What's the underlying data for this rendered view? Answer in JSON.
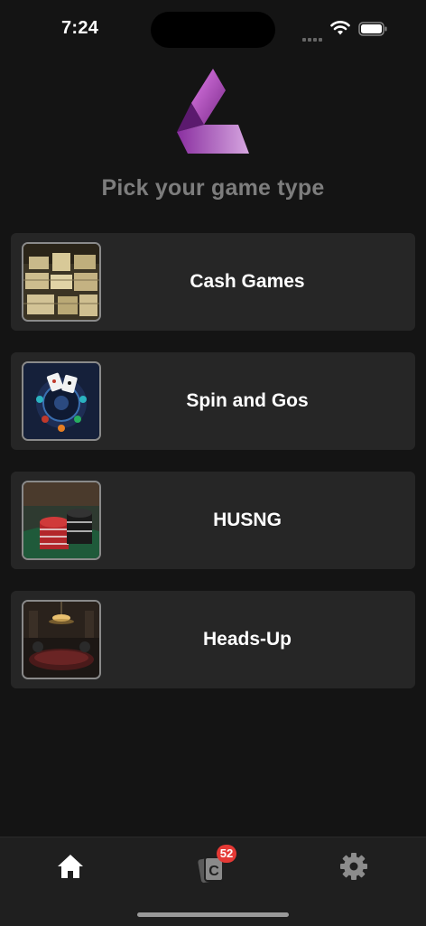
{
  "status_bar": {
    "time": "7:24"
  },
  "header": {
    "title": "Pick your game type"
  },
  "game_types": [
    {
      "label": "Cash Games",
      "icon": "money-stacks-image"
    },
    {
      "label": "Spin and Gos",
      "icon": "spin-wheel-image"
    },
    {
      "label": "HUSNG",
      "icon": "poker-chips-image"
    },
    {
      "label": "Heads-Up",
      "icon": "poker-room-image"
    }
  ],
  "tab_bar": {
    "items": [
      {
        "name": "home",
        "icon": "home-icon",
        "active": true
      },
      {
        "name": "cards",
        "icon": "cards-icon",
        "badge": "52"
      },
      {
        "name": "settings",
        "icon": "gear-icon"
      }
    ]
  },
  "colors": {
    "background": "#141414",
    "card": "#262626",
    "heading": "#7d7d7d",
    "badge": "#e53935",
    "logo_gradient": [
      "#5b1a6e",
      "#c04ad0",
      "#e07be8"
    ]
  }
}
